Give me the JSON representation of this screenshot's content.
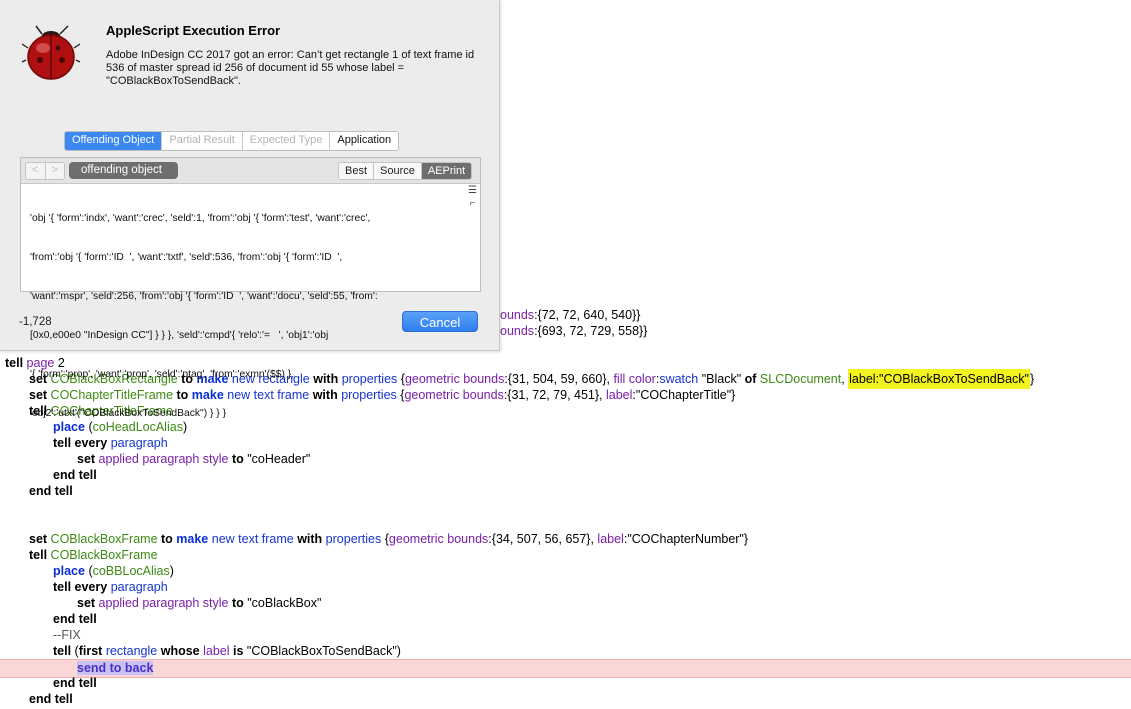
{
  "dialog": {
    "title": "AppleScript Execution Error",
    "message": "Adobe InDesign CC 2017 got an error: Can’t get rectangle 1 of text frame id 536 of master spread id 256 of document id 55 whose label = \"COBlackBoxToSendBack\".",
    "tabs": [
      "Offending Object",
      "Partial Result",
      "Expected Type",
      "Application"
    ],
    "active_tab": "Offending Object",
    "panel_title": "offending object",
    "nav_back": "<",
    "nav_forward": ">",
    "format_options": [
      "Best",
      "Source",
      "AEPrint"
    ],
    "active_format": "AEPrint",
    "object_lines": [
      "'obj '{ 'form':'indx', 'want':'crec', 'seld':1, 'from':'obj '{ 'form':'test', 'want':'crec',",
      "'from':'obj '{ 'form':'ID  ', 'want':'txtf', 'seld':536, 'from':'obj '{ 'form':'ID  ',",
      "'want':'mspr', 'seld':256, 'from':'obj '{ 'form':'ID  ', 'want':'docu', 'seld':55, 'from':",
      "[0x0,e00e0 \"InDesign CC\"] } } }, 'seld':'cmpd'{ 'relo':'=   ', 'obj1':'obj",
      "'{ 'form':'prop', 'want':'prop', 'seld':'ptag', 'from':'exmn'($$) },",
      "'obj2':'utxt'(\"COBlackBoxToSendBack\") } } }"
    ],
    "error_number": "-1,728",
    "cancel_label": "Cancel"
  },
  "fragments": {
    "line1_prop": "ounds",
    "line1_val": ":{72, 72, 640, 540}}",
    "line2_prop": "ounds",
    "line2_val": ":{693, 72, 729, 558}}"
  },
  "code": {
    "lines": [
      {
        "indent": 0,
        "tokens": [
          [
            "kw",
            "tell "
          ],
          [
            "prop",
            "page"
          ],
          [
            "plain",
            " 2"
          ]
        ]
      },
      {
        "indent": 1,
        "tokens": [
          [
            "kw",
            "set "
          ],
          [
            "var",
            "COBlackBoxRectangle"
          ],
          [
            "kw",
            " to "
          ],
          [
            "kwb",
            "make"
          ],
          [
            "cls",
            " new rectangle"
          ],
          [
            "kw",
            " with "
          ],
          [
            "cls",
            "properties"
          ],
          [
            "plain",
            " {"
          ],
          [
            "prop",
            "geometric bounds"
          ],
          [
            "plain",
            ":{31, 504, 59, 660}, "
          ],
          [
            "prop",
            "fill color"
          ],
          [
            "plain",
            ":"
          ],
          [
            "cls",
            "swatch"
          ],
          [
            "plain",
            " \"Black\" "
          ],
          [
            "kw",
            "of"
          ],
          [
            "plain",
            " "
          ],
          [
            "var",
            "SLCDocument"
          ],
          [
            "plain",
            ", "
          ],
          [
            "hl",
            "label:\"COBlackBoxToSendBack\""
          ],
          [
            "plain",
            "}"
          ]
        ]
      },
      {
        "indent": 1,
        "tokens": [
          [
            "kw",
            "set "
          ],
          [
            "var",
            "COChapterTitleFrame"
          ],
          [
            "kw",
            " to "
          ],
          [
            "kwb",
            "make"
          ],
          [
            "cls",
            " new text frame"
          ],
          [
            "kw",
            " with "
          ],
          [
            "cls",
            "properties"
          ],
          [
            "plain",
            " {"
          ],
          [
            "prop",
            "geometric bounds"
          ],
          [
            "plain",
            ":{31, 72, 79, 451}, "
          ],
          [
            "prop",
            "label"
          ],
          [
            "plain",
            ":\"COChapterTitle\"}"
          ]
        ]
      },
      {
        "indent": 1,
        "tokens": [
          [
            "kw",
            "tell "
          ],
          [
            "var",
            "COChapterTitleFrame"
          ]
        ]
      },
      {
        "indent": 2,
        "tokens": [
          [
            "kwb",
            "place"
          ],
          [
            "plain",
            " ("
          ],
          [
            "var",
            "coHeadLocAlias"
          ],
          [
            "plain",
            ")"
          ]
        ]
      },
      {
        "indent": 2,
        "tokens": [
          [
            "kw",
            "tell every "
          ],
          [
            "cls",
            "paragraph"
          ]
        ]
      },
      {
        "indent": 3,
        "tokens": [
          [
            "kw",
            "set "
          ],
          [
            "prop",
            "applied paragraph style"
          ],
          [
            "kw",
            " to "
          ],
          [
            "plain",
            "\"coHeader\""
          ]
        ]
      },
      {
        "indent": 2,
        "tokens": [
          [
            "kw",
            "end tell"
          ]
        ]
      },
      {
        "indent": 1,
        "tokens": [
          [
            "kw",
            "end tell"
          ]
        ]
      },
      {
        "indent": 0,
        "tokens": []
      },
      {
        "indent": 0,
        "tokens": []
      },
      {
        "indent": 1,
        "tokens": [
          [
            "kw",
            "set "
          ],
          [
            "var",
            "COBlackBoxFrame"
          ],
          [
            "kw",
            " to "
          ],
          [
            "kwb",
            "make"
          ],
          [
            "cls",
            " new text frame"
          ],
          [
            "kw",
            " with "
          ],
          [
            "cls",
            "properties"
          ],
          [
            "plain",
            " {"
          ],
          [
            "prop",
            "geometric bounds"
          ],
          [
            "plain",
            ":{34, 507, 56, 657}, "
          ],
          [
            "prop",
            "label"
          ],
          [
            "plain",
            ":\"COChapterNumber\"}"
          ]
        ]
      },
      {
        "indent": 1,
        "tokens": [
          [
            "kw",
            "tell "
          ],
          [
            "var",
            "COBlackBoxFrame"
          ]
        ]
      },
      {
        "indent": 2,
        "tokens": [
          [
            "kwb",
            "place"
          ],
          [
            "plain",
            " ("
          ],
          [
            "var",
            "coBBLocAlias"
          ],
          [
            "plain",
            ")"
          ]
        ]
      },
      {
        "indent": 2,
        "tokens": [
          [
            "kw",
            "tell every "
          ],
          [
            "cls",
            "paragraph"
          ]
        ]
      },
      {
        "indent": 3,
        "tokens": [
          [
            "kw",
            "set "
          ],
          [
            "prop",
            "applied paragraph style"
          ],
          [
            "kw",
            " to "
          ],
          [
            "plain",
            "\"coBlackBox\""
          ]
        ]
      },
      {
        "indent": 2,
        "tokens": [
          [
            "kw",
            "end tell"
          ]
        ]
      },
      {
        "indent": 2,
        "tokens": [
          [
            "cmt",
            "--FIX"
          ]
        ]
      },
      {
        "indent": 2,
        "tokens": [
          [
            "kw",
            "tell "
          ],
          [
            "plain",
            "("
          ],
          [
            "kw",
            "first "
          ],
          [
            "cls",
            "rectangle"
          ],
          [
            "kw",
            " whose "
          ],
          [
            "prop",
            "label"
          ],
          [
            "kw",
            " is "
          ],
          [
            "plain",
            "\"COBlackBoxToSendBack\")"
          ]
        ]
      },
      {
        "indent": 3,
        "error": true,
        "tokens": [
          [
            "sel",
            "send to back"
          ]
        ]
      },
      {
        "indent": 2,
        "tokens": [
          [
            "kw",
            "end tell"
          ]
        ]
      },
      {
        "indent": 1,
        "tokens": [
          [
            "kw",
            "end tell"
          ]
        ]
      }
    ]
  },
  "colors": {
    "accent_blue": "#3b88f3",
    "error_line": "#fbd6d6",
    "highlight": "#f3f31f",
    "variable_green": "#3d8b14",
    "property_purple": "#7a1fa8",
    "class_blue": "#1634cc"
  }
}
